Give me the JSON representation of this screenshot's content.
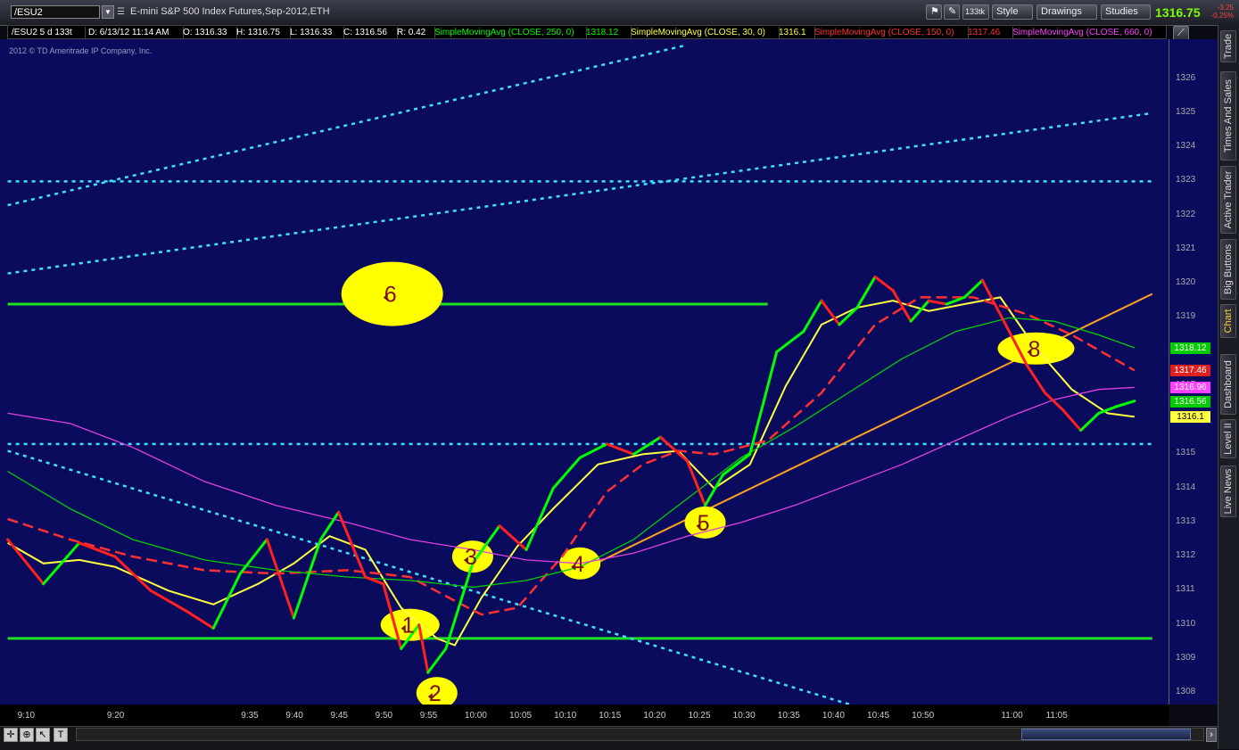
{
  "toolbar": {
    "symbol": "/ESU2",
    "description": "E-mini S&P 500 Index Futures,Sep-2012,ETH",
    "aggregation_label": "133tk",
    "style_label": "Style",
    "drawings_label": "Drawings",
    "studies_label": "Studies",
    "last_price": "1316.75",
    "net_change": "-3.25",
    "pct_change": "-0.25%"
  },
  "info_bar": {
    "symbol_period": "/ESU2 5 d 133t",
    "datetime": "D: 6/13/12 11:14 AM",
    "open": "O: 1316.33",
    "high": "H: 1316.75",
    "low": "L: 1316.33",
    "close": "C: 1316.56",
    "range": "R: 0.42",
    "study1": "SimpleMovingAvg (CLOSE, 250, 0)",
    "study1_value": "1318.12",
    "study2": "SimpleMovingAvg (CLOSE, 30, 0)",
    "study2_value": "1316.1",
    "study3": "SimpleMovingAvg (CLOSE, 150, 0)",
    "study3_value": "1317.46",
    "study4": "SimpleMovingAvg (CLOSE, 660, 0)",
    "colors": {
      "study1": "#00ff00",
      "study2": "#ffff40",
      "study3": "#ff3030",
      "study4": "#ff40ff"
    }
  },
  "copyright": "2012 © TD Ameritrade IP Company, Inc.",
  "sidebar_tabs": [
    "Trade",
    "Times And Sales",
    "Active Trader",
    "Big Buttons",
    "Chart",
    "Dashboard",
    "Level II",
    "Live News"
  ],
  "chart_data": {
    "type": "line",
    "title": "",
    "xlabel": "",
    "ylabel": "",
    "ylim": [
      1307.3,
      1327.0
    ],
    "y_ticks": [
      1308,
      1309,
      1310,
      1311,
      1312,
      1313,
      1314,
      1315,
      1316,
      1317,
      1318,
      1319,
      1320,
      1321,
      1322,
      1323,
      1324,
      1325,
      1326
    ],
    "x_range": [
      "9:08",
      "11:14"
    ],
    "x_ticks": [
      "9:10",
      "9:20",
      "9:35",
      "9:40",
      "9:45",
      "9:50",
      "9:55",
      "10:00",
      "10:05",
      "10:10",
      "10:15",
      "10:20",
      "10:25",
      "10:30",
      "10:35",
      "10:40",
      "10:45",
      "10:50",
      "11:00",
      "11:05"
    ],
    "price_badges": [
      {
        "value": "1318.12",
        "color": "#00cc00"
      },
      {
        "value": "1317.46",
        "color": "#e02020"
      },
      {
        "value": "1316.96",
        "color": "#ff40ff"
      },
      {
        "value": "1316.56",
        "color": "#00cc00"
      },
      {
        "value": "1316.1",
        "color": "#ffff40"
      }
    ],
    "series": [
      {
        "kind": "price",
        "colors": {
          "up": "#00ff00",
          "down": "#ff2020"
        },
        "x": [
          "9:08",
          "9:12",
          "9:16",
          "9:20",
          "9:24",
          "9:28",
          "9:31",
          "9:34",
          "9:37",
          "9:40",
          "9:43",
          "9:45",
          "9:48",
          "9:50",
          "9:52",
          "9:54",
          "9:55",
          "9:57",
          "10:00",
          "10:03",
          "10:06",
          "10:09",
          "10:12",
          "10:15",
          "10:18",
          "10:21",
          "10:24",
          "10:26",
          "10:28",
          "10:31",
          "10:34",
          "10:37",
          "10:39",
          "10:41",
          "10:43",
          "10:45",
          "10:47",
          "10:49",
          "10:51",
          "10:53",
          "10:55",
          "10:57",
          "11:00",
          "11:02",
          "11:04",
          "11:06",
          "11:08",
          "11:10",
          "11:12",
          "11:14"
        ],
        "values": [
          1312.5,
          1311.2,
          1312.4,
          1312.0,
          1311.0,
          1310.4,
          1309.9,
          1311.5,
          1312.5,
          1310.2,
          1312.5,
          1313.3,
          1311.4,
          1311.2,
          1309.3,
          1310.0,
          1308.6,
          1309.3,
          1311.8,
          1312.9,
          1312.2,
          1314.0,
          1314.9,
          1315.3,
          1315.0,
          1315.5,
          1314.8,
          1313.5,
          1314.4,
          1315.0,
          1318.0,
          1318.6,
          1319.5,
          1318.8,
          1319.3,
          1320.2,
          1319.8,
          1318.9,
          1319.5,
          1319.4,
          1319.6,
          1320.1,
          1318.6,
          1317.6,
          1316.8,
          1316.3,
          1315.7,
          1316.2,
          1316.4,
          1316.56
        ]
      },
      {
        "kind": "sma",
        "color": "#ffff40",
        "dash": "solid",
        "x": [
          "9:08",
          "9:12",
          "9:16",
          "9:20",
          "9:26",
          "9:31",
          "9:36",
          "9:40",
          "9:44",
          "9:48",
          "9:52",
          "9:56",
          "9:58",
          "10:01",
          "10:05",
          "10:09",
          "10:14",
          "10:19",
          "10:23",
          "10:27",
          "10:31",
          "10:35",
          "10:39",
          "10:43",
          "10:47",
          "10:51",
          "10:55",
          "10:59",
          "11:03",
          "11:07",
          "11:11",
          "11:14"
        ],
        "values": [
          1312.4,
          1311.8,
          1311.9,
          1311.7,
          1311.0,
          1310.6,
          1311.2,
          1311.8,
          1312.6,
          1312.2,
          1310.5,
          1309.6,
          1309.4,
          1310.8,
          1312.3,
          1313.4,
          1314.7,
          1315.0,
          1315.1,
          1314.0,
          1314.7,
          1317.0,
          1318.8,
          1319.3,
          1319.5,
          1319.2,
          1319.4,
          1319.6,
          1318.1,
          1316.9,
          1316.2,
          1316.1
        ]
      },
      {
        "kind": "sma",
        "color": "#ff3030",
        "dash": "dashed",
        "x": [
          "9:08",
          "9:15",
          "9:22",
          "9:30",
          "9:38",
          "9:46",
          "9:53",
          "9:58",
          "10:01",
          "10:05",
          "10:10",
          "10:15",
          "10:19",
          "10:23",
          "10:27",
          "10:33",
          "10:39",
          "10:45",
          "10:50",
          "10:56",
          "11:02",
          "11:07",
          "11:14"
        ],
        "values": [
          1313.1,
          1312.5,
          1312.0,
          1311.6,
          1311.5,
          1311.6,
          1311.4,
          1310.7,
          1310.3,
          1310.5,
          1312.0,
          1313.9,
          1314.7,
          1315.1,
          1315.0,
          1315.4,
          1316.8,
          1318.8,
          1319.6,
          1319.6,
          1319.1,
          1318.5,
          1317.46
        ]
      },
      {
        "kind": "sma",
        "color": "#00d000",
        "dash": "solid",
        "x": [
          "9:08",
          "9:15",
          "9:22",
          "9:30",
          "9:38",
          "9:46",
          "9:53",
          "10:00",
          "10:06",
          "10:12",
          "10:18",
          "10:24",
          "10:30",
          "10:36",
          "10:42",
          "10:48",
          "10:54",
          "11:00",
          "11:05",
          "11:10",
          "11:14"
        ],
        "values": [
          1314.5,
          1313.4,
          1312.5,
          1311.9,
          1311.6,
          1311.4,
          1311.3,
          1311.1,
          1311.3,
          1311.7,
          1312.5,
          1313.7,
          1314.9,
          1315.8,
          1316.8,
          1317.8,
          1318.6,
          1319.0,
          1318.9,
          1318.5,
          1318.12
        ]
      },
      {
        "kind": "sma",
        "color": "#e040e0",
        "dash": "solid",
        "x": [
          "9:08",
          "9:15",
          "9:22",
          "9:30",
          "9:38",
          "9:46",
          "9:53",
          "10:00",
          "10:06",
          "10:12",
          "10:18",
          "10:24",
          "10:30",
          "10:36",
          "10:42",
          "10:48",
          "10:54",
          "11:00",
          "11:05",
          "11:10",
          "11:14"
        ],
        "values": [
          1316.2,
          1315.9,
          1315.2,
          1314.2,
          1313.5,
          1313.0,
          1312.5,
          1312.2,
          1311.9,
          1311.8,
          1312.1,
          1312.6,
          1313.0,
          1313.5,
          1314.1,
          1314.7,
          1315.4,
          1316.1,
          1316.6,
          1316.9,
          1316.96
        ]
      }
    ],
    "reference_lines": [
      {
        "kind": "horizontal",
        "color": "#20e020",
        "style": "solid",
        "y": 1319.4,
        "x_start": "9:08",
        "x_end": "10:33"
      },
      {
        "kind": "horizontal",
        "color": "#20e020",
        "style": "solid",
        "y": 1309.6,
        "x_start": "9:08",
        "x_end": "11:16"
      },
      {
        "kind": "horizontal",
        "color": "#40e0ff",
        "style": "dotted",
        "y": 1323.0,
        "x_start": "9:08",
        "x_end": "11:16"
      },
      {
        "kind": "horizontal",
        "color": "#40e0ff",
        "style": "dotted",
        "y": 1315.3,
        "x_start": "9:08",
        "x_end": "11:16"
      },
      {
        "kind": "trend",
        "color": "#40e0ff",
        "style": "dotted",
        "points": [
          [
            "9:08",
            1322.3
          ],
          [
            "10:24",
            1327.0
          ]
        ]
      },
      {
        "kind": "trend",
        "color": "#40e0ff",
        "style": "dotted",
        "points": [
          [
            "9:08",
            1320.3
          ],
          [
            "11:16",
            1325.0
          ]
        ]
      },
      {
        "kind": "trend",
        "color": "#40e0ff",
        "style": "dotted",
        "points": [
          [
            "9:08",
            1315.1
          ],
          [
            "10:43",
            1307.6
          ]
        ]
      },
      {
        "kind": "trend",
        "color": "#ffa020",
        "style": "solid",
        "points": [
          [
            "10:13",
            1311.7
          ],
          [
            "11:16",
            1319.7
          ]
        ]
      }
    ],
    "annotations": [
      {
        "label": "1",
        "x": "9:53",
        "y": 1310.0
      },
      {
        "label": "2",
        "x": "9:56",
        "y": 1308.0
      },
      {
        "label": "3",
        "x": "10:00",
        "y": 1312.0
      },
      {
        "label": "4",
        "x": "10:12",
        "y": 1311.8
      },
      {
        "label": "5",
        "x": "10:26",
        "y": 1313.0
      },
      {
        "label": "6",
        "x": "9:51",
        "y": 1319.7
      },
      {
        "label": "8",
        "x": "11:03",
        "y": 1318.1
      }
    ]
  }
}
